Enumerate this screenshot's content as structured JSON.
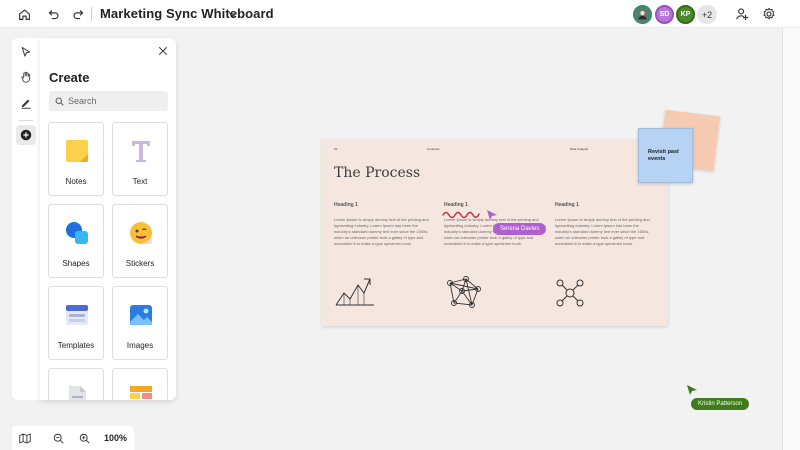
{
  "header": {
    "title": "Marketing Sync Whiteboard",
    "more_collaborators": "+2",
    "avatars": [
      {
        "initials": "",
        "color": "#5d7a6f"
      },
      {
        "initials": "SD",
        "color": "#b877d8"
      },
      {
        "initials": "KP",
        "color": "#4e8a2c"
      }
    ],
    "icons": [
      "home-icon",
      "undo-icon",
      "redo-icon",
      "chevron-down-icon",
      "share-people-icon",
      "settings-icon"
    ]
  },
  "tools": [
    {
      "name": "select-tool",
      "icon": "pointer-arrow-icon"
    },
    {
      "name": "pan-tool",
      "icon": "hand-icon"
    },
    {
      "name": "ink-tool",
      "icon": "pen-icon"
    },
    {
      "name": "add-tool",
      "icon": "plus-circle-icon"
    }
  ],
  "create_panel": {
    "title": "Create",
    "search_placeholder": "Search",
    "tiles": [
      {
        "label": "Notes",
        "icon": "sticky-note-icon"
      },
      {
        "label": "Text",
        "icon": "text-icon"
      },
      {
        "label": "Shapes",
        "icon": "shapes-icon"
      },
      {
        "label": "Stickers",
        "icon": "sticker-icon"
      },
      {
        "label": "Templates",
        "icon": "templates-icon"
      },
      {
        "label": "Images",
        "icon": "image-icon"
      },
      {
        "label": "",
        "icon": "document-icon"
      },
      {
        "label": "",
        "icon": "grid-icon"
      }
    ]
  },
  "zoom": {
    "level": "100%",
    "icons": [
      "map-icon",
      "zoom-out-icon",
      "zoom-in-icon"
    ]
  },
  "slide": {
    "top_left": "01",
    "top_center": "Centered",
    "top_right": "Date Analysis",
    "title": "The Process",
    "columns": [
      {
        "heading": "Heading 1",
        "body": "Lorem Ipsum is simply dummy text of the printing and typesetting industry. Lorem Ipsum has been the industry's standard dummy text ever since the 1500s, when an unknown printer took a galley of type and scrambled it to make a type specimen book."
      },
      {
        "heading": "Heading 1",
        "body": "Lorem Ipsum is simply dummy text of the printing and typesetting industry. Lorem Ipsum has been the industry's standard dummy text ever since the 1500s, when an unknown printer took a galley of type and scrambled it to make a type specimen book."
      },
      {
        "heading": "Heading 1",
        "body": "Lorem Ipsum is simply dummy text of the printing and typesetting industry. Lorem Ipsum has been the industry's standard dummy text ever since the 1500s, when an unknown printer took a galley of type and scrambled it to make a type specimen book."
      }
    ]
  },
  "sticky_notes": {
    "front_text": "Revisit past events",
    "front_color": "#b6d3f3",
    "back_color": "#f7cbb1"
  },
  "cursors": [
    {
      "name": "Serena Davies",
      "color": "#b05fd0"
    },
    {
      "name": "Kristin Patterson",
      "color": "#3f7c1c"
    }
  ],
  "colors": {
    "accent_ink": "#c0303a",
    "slide_bg": "#f6e6e0"
  }
}
